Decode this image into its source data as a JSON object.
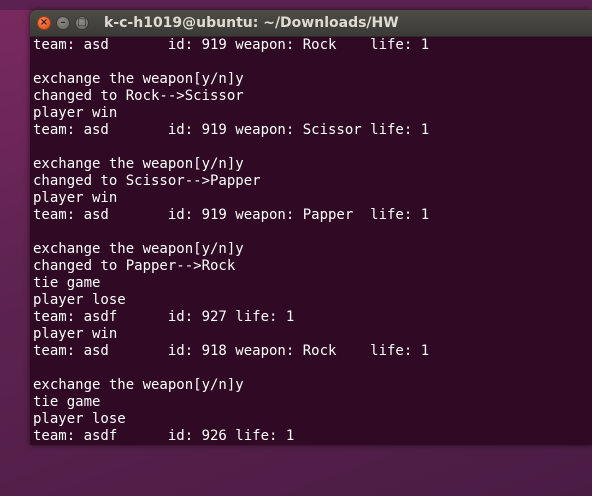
{
  "window": {
    "title": "k-c-h1019@ubuntu: ~/Downloads/HW",
    "close_glyph": "×",
    "minimize_glyph": "–",
    "maximize_glyph": "□"
  },
  "terminal": {
    "background_color": "#300a24",
    "text_color": "#ffffff",
    "lines": [
      "team: asd       id: 919 weapon: Rock    life: 1",
      "",
      "exchange the weapon[y/n]y",
      "changed to Rock-->Scissor",
      "player win",
      "team: asd       id: 919 weapon: Scissor life: 1",
      "",
      "exchange the weapon[y/n]y",
      "changed to Scissor-->Papper",
      "player win",
      "team: asd       id: 919 weapon: Papper  life: 1",
      "",
      "exchange the weapon[y/n]y",
      "changed to Papper-->Rock",
      "tie game",
      "player lose",
      "team: asdf      id: 927 life: 1",
      "player win",
      "team: asd       id: 918 weapon: Rock    life: 1",
      "",
      "exchange the weapon[y/n]y",
      "tie game",
      "player lose",
      "team: asdf      id: 926 life: 1"
    ]
  }
}
